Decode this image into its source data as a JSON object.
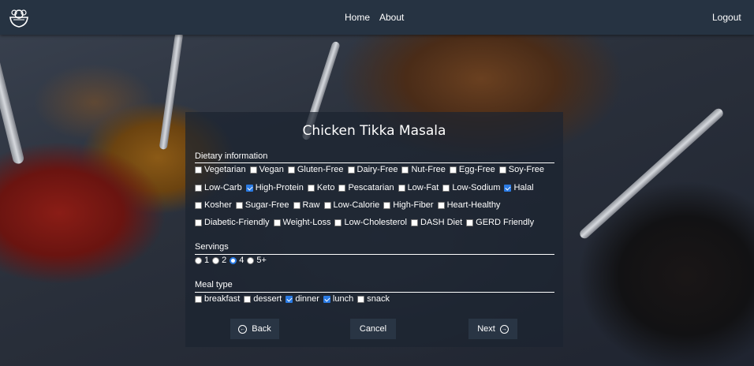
{
  "nav": {
    "logo_icon": "salad-bowl-logo-icon",
    "links": [
      "Home",
      "About"
    ],
    "logout": "Logout"
  },
  "recipe": {
    "title": "Chicken Tikka Masala"
  },
  "dietary": {
    "label": "Dietary information",
    "rows": [
      [
        {
          "label": "Vegetarian",
          "checked": false
        },
        {
          "label": "Vegan",
          "checked": false
        },
        {
          "label": "Gluten-Free",
          "checked": false
        },
        {
          "label": "Dairy-Free",
          "checked": false
        },
        {
          "label": "Nut-Free",
          "checked": false
        },
        {
          "label": "Egg-Free",
          "checked": false
        },
        {
          "label": "Soy-Free",
          "checked": false
        }
      ],
      [
        {
          "label": "Low-Carb",
          "checked": false
        },
        {
          "label": "High-Protein",
          "checked": true
        },
        {
          "label": "Keto",
          "checked": false
        },
        {
          "label": "Pescatarian",
          "checked": false
        },
        {
          "label": "Low-Fat",
          "checked": false
        },
        {
          "label": "Low-Sodium",
          "checked": false
        },
        {
          "label": "Halal",
          "checked": true
        }
      ],
      [
        {
          "label": "Kosher",
          "checked": false
        },
        {
          "label": "Sugar-Free",
          "checked": false
        },
        {
          "label": "Raw",
          "checked": false
        },
        {
          "label": "Low-Calorie",
          "checked": false
        },
        {
          "label": "High-Fiber",
          "checked": false
        },
        {
          "label": "Heart-Healthy",
          "checked": false
        }
      ],
      [
        {
          "label": "Diabetic-Friendly",
          "checked": false
        },
        {
          "label": "Weight-Loss",
          "checked": false
        },
        {
          "label": "Low-Cholesterol",
          "checked": false
        },
        {
          "label": "DASH Diet",
          "checked": false
        },
        {
          "label": "GERD Friendly",
          "checked": false
        }
      ]
    ]
  },
  "servings": {
    "label": "Servings",
    "options": [
      {
        "label": "1",
        "selected": false
      },
      {
        "label": "2",
        "selected": false
      },
      {
        "label": "4",
        "selected": true
      },
      {
        "label": "5+",
        "selected": false
      }
    ]
  },
  "meal_type": {
    "label": "Meal type",
    "options": [
      {
        "label": "breakfast",
        "checked": false
      },
      {
        "label": "dessert",
        "checked": false
      },
      {
        "label": "dinner",
        "checked": true
      },
      {
        "label": "lunch",
        "checked": true
      },
      {
        "label": "snack",
        "checked": false
      }
    ]
  },
  "actions": {
    "back": "Back",
    "cancel": "Cancel",
    "next": "Next",
    "back_icon": "arrow-left-circle-icon",
    "next_icon": "arrow-right-circle-icon"
  },
  "colors": {
    "nav_bg": "#263342",
    "accent": "#2b7be4"
  }
}
